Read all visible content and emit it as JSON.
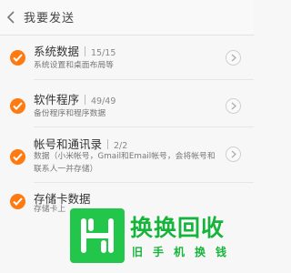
{
  "header": {
    "title": "我要发送",
    "back_icon": "back-chevron-icon"
  },
  "items": [
    {
      "name": "系统数据",
      "count": "15/15",
      "desc": "系统设置和桌面布局等",
      "checked": true
    },
    {
      "name": "软件程序",
      "count": "49/49",
      "desc": "备份程序和程序数据",
      "checked": true
    },
    {
      "name": "帐号和通讯录",
      "count": "2/2",
      "desc": "数据（小米帐号，Gmail和Email帐号，会将帐号和联系人一并存储）",
      "checked": true
    },
    {
      "name": "存储卡数据",
      "count": "",
      "desc": "存储卡上",
      "checked": true
    }
  ],
  "watermark": {
    "title": "换换回收",
    "subtitle": [
      "旧",
      "手",
      "机",
      "换",
      "钱"
    ]
  },
  "colors": {
    "accent": "#ff7a10",
    "watermark": "#17b43c"
  }
}
